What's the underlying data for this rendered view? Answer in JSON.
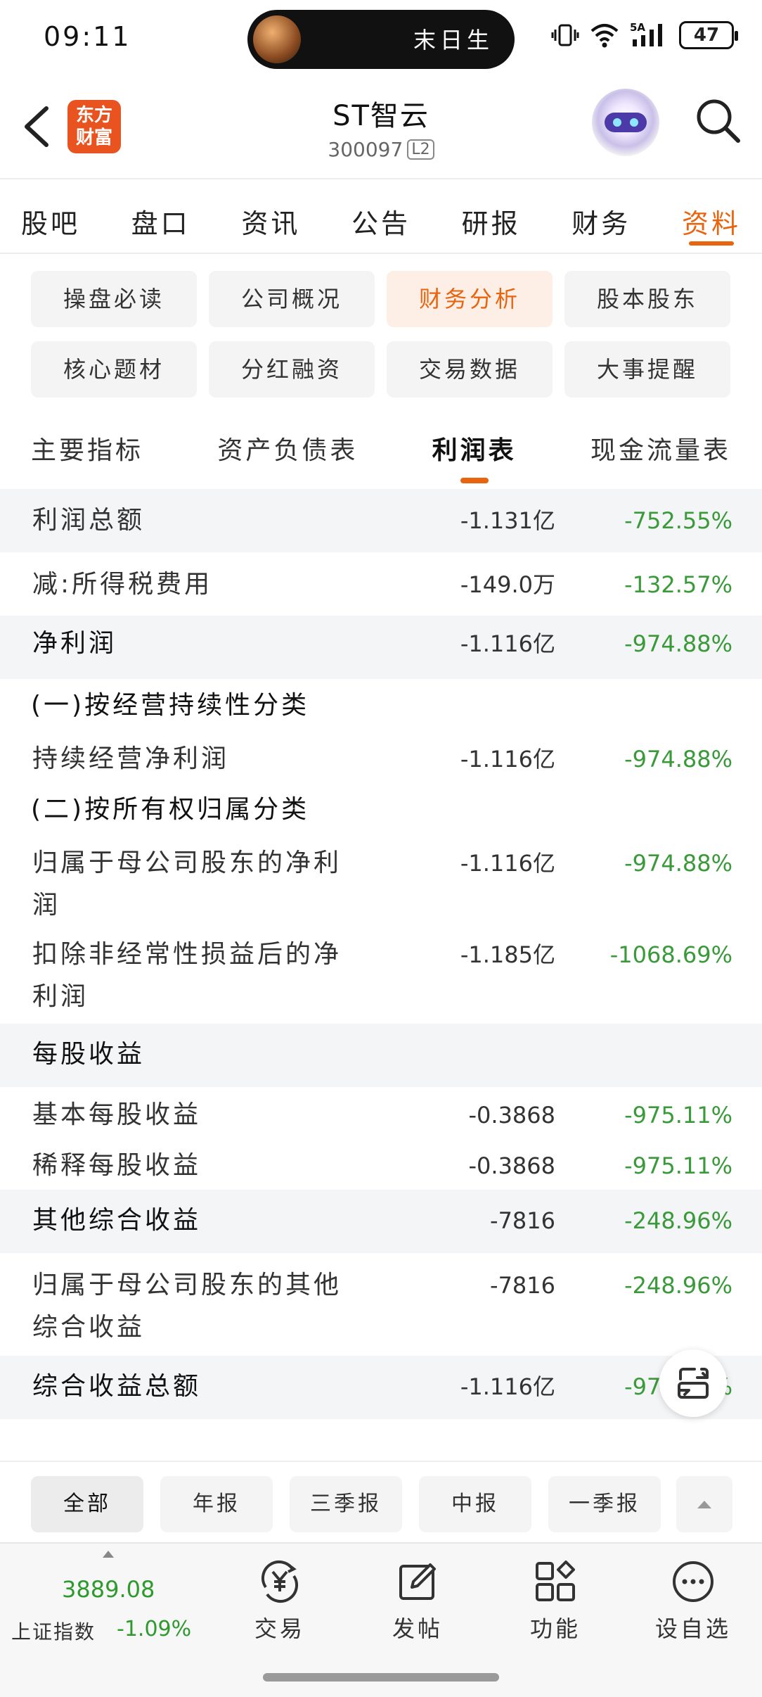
{
  "status_bar": {
    "time": "09:11",
    "island_text": "末日生",
    "network": "5A",
    "battery": "47"
  },
  "header": {
    "logo_text": "东方财富",
    "stock_name": "ST智云",
    "stock_code": "300097",
    "level_badge": "L2"
  },
  "main_tabs": [
    "股吧",
    "盘口",
    "资讯",
    "公告",
    "研报",
    "财务",
    "资料"
  ],
  "main_tab_active": "资料",
  "categories": [
    "操盘必读",
    "公司概况",
    "财务分析",
    "股本股东",
    "核心题材",
    "分红融资",
    "交易数据",
    "大事提醒"
  ],
  "category_active": "财务分析",
  "sub_tabs": [
    "主要指标",
    "资产负债表",
    "利润表",
    "现金流量表"
  ],
  "sub_tab_active": "利润表",
  "table": {
    "r1": {
      "label": "利润总额",
      "value": "-1.131亿",
      "pct": "-752.55%"
    },
    "r2": {
      "label": "减:所得税费用",
      "value": "-149.0万",
      "pct": "-132.57%"
    },
    "r3": {
      "label": "净利润",
      "value": "-1.116亿",
      "pct": "-974.88%"
    },
    "s1": "(一)按经营持续性分类",
    "r4": {
      "label": "持续经营净利润",
      "value": "-1.116亿",
      "pct": "-974.88%"
    },
    "s2": "(二)按所有权归属分类",
    "r5": {
      "label_line1": "归属于母公司股东的净利",
      "label_line2": "润",
      "value": "-1.116亿",
      "pct": "-974.88%"
    },
    "r6": {
      "label_line1": "扣除非经常性损益后的净",
      "label_line2": "利润",
      "value": "-1.185亿",
      "pct": "-1068.69%"
    },
    "r7": {
      "label": "每股收益"
    },
    "r8": {
      "label": "基本每股收益",
      "value": "-0.3868",
      "pct": "-975.11%"
    },
    "r9": {
      "label": "稀释每股收益",
      "value": "-0.3868",
      "pct": "-975.11%"
    },
    "r10": {
      "label": "其他综合收益",
      "value": "-7816",
      "pct": "-248.96%"
    },
    "r11": {
      "label_line1": "归属于母公司股东的其他",
      "label_line2": "综合收益",
      "value": "-7816",
      "pct": "-248.96%"
    },
    "r12": {
      "label": "综合收益总额",
      "value": "-1.116亿",
      "pct": "-975.11%"
    }
  },
  "periods": [
    "全部",
    "年报",
    "三季报",
    "中报",
    "一季报"
  ],
  "period_active": "全部",
  "index": {
    "value": "3889.08",
    "name": "上证指数",
    "change": "-1.09%"
  },
  "nav": {
    "trade": "交易",
    "post": "发帖",
    "function": "功能",
    "watchlist": "设自选"
  },
  "colors": {
    "accent": "#e8640f",
    "down_green": "#3a9a3a",
    "logo_bg": "#e8531f"
  }
}
